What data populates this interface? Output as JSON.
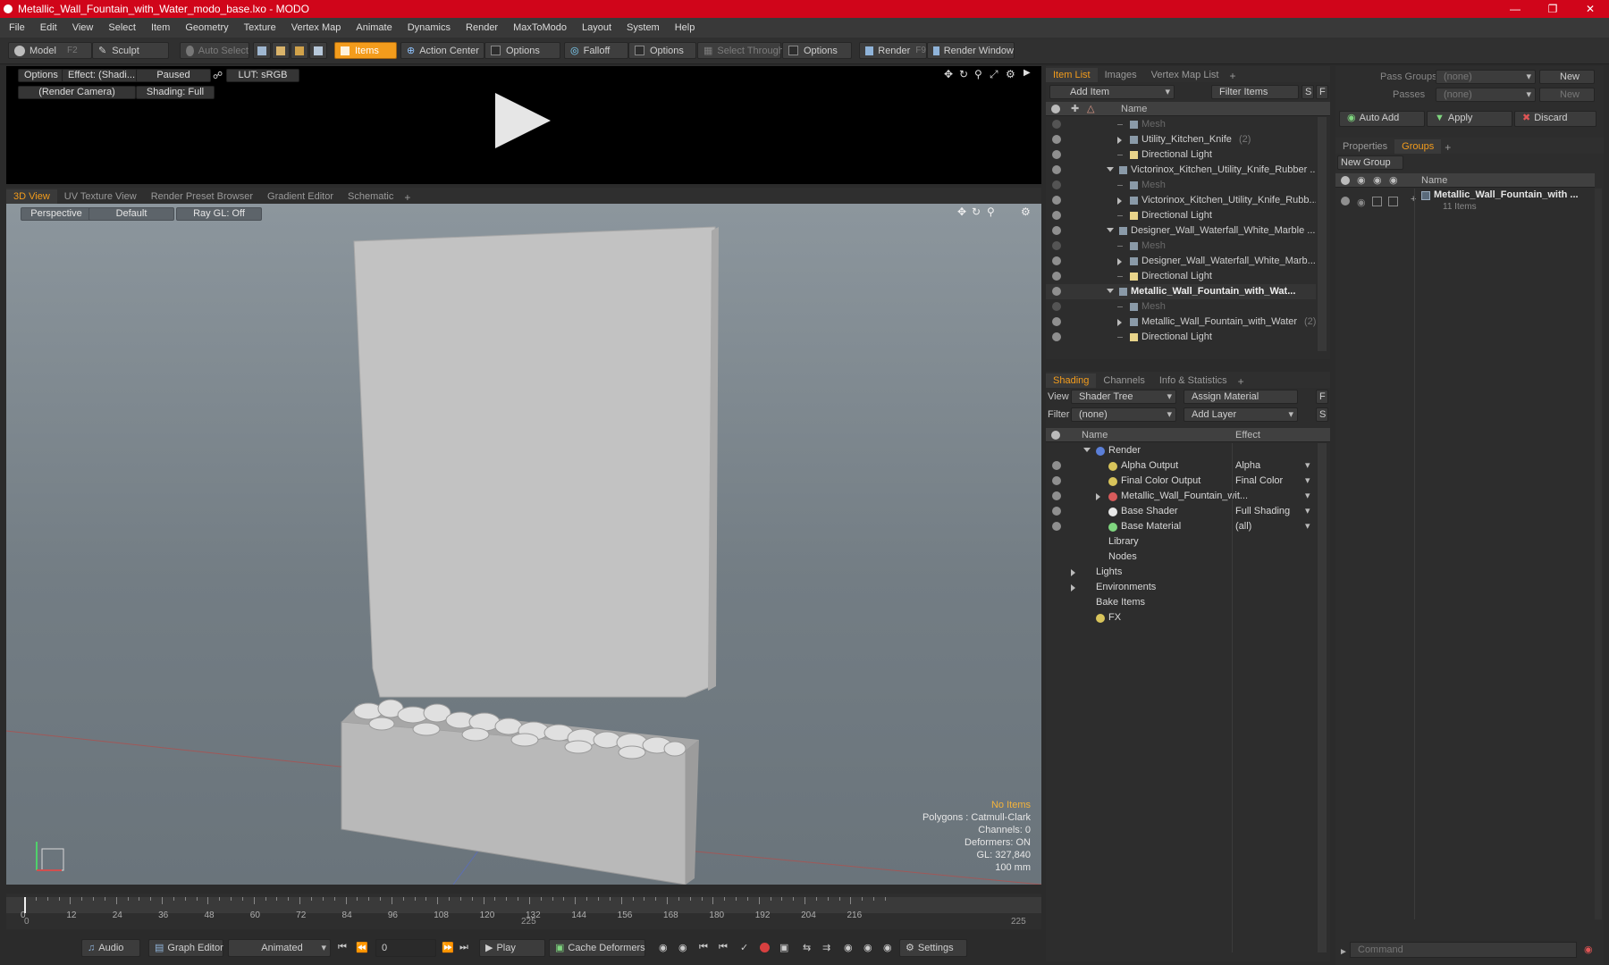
{
  "window": {
    "title": "Metallic_Wall_Fountain_with_Water_modo_base.lxo - MODO"
  },
  "menu": [
    "File",
    "Edit",
    "View",
    "Select",
    "Item",
    "Geometry",
    "Texture",
    "Vertex Map",
    "Animate",
    "Dynamics",
    "Render",
    "MaxToModo",
    "Layout",
    "System",
    "Help"
  ],
  "toolbar": {
    "model": "Model",
    "model_key": "F2",
    "sculpt": "Sculpt",
    "auto_select": "Auto Select",
    "items": "Items",
    "action_center": "Action Center",
    "options1": "Options",
    "falloff": "Falloff",
    "options2": "Options",
    "select_through": "Select Through",
    "options3": "Options",
    "render": "Render",
    "render_key": "F9",
    "render_window": "Render Window"
  },
  "preview": {
    "options": "Options",
    "effect": "Effect: (Shadi...",
    "paused": "Paused",
    "lut": "LUT: sRGB",
    "camera": "(Render Camera)",
    "shading": "Shading: Full"
  },
  "viewport_tabs": [
    "3D View",
    "UV Texture View",
    "Render Preset Browser",
    "Gradient Editor",
    "Schematic"
  ],
  "viewport": {
    "perspective": "Perspective",
    "default": "Default",
    "raygl": "Ray GL: Off",
    "stats": [
      "No Items",
      "Polygons : Catmull-Clark",
      "Channels: 0",
      "Deformers: ON",
      "GL: 327,840",
      "100 mm"
    ]
  },
  "timeline": {
    "ticks": [
      "0",
      "12",
      "24",
      "36",
      "48",
      "60",
      "72",
      "84",
      "96",
      "108",
      "120",
      "132",
      "144",
      "156",
      "168",
      "180",
      "192",
      "204",
      "216"
    ],
    "start": "0",
    "mid": "225",
    "end": "225"
  },
  "transport": {
    "audio": "Audio",
    "graph_editor": "Graph Editor",
    "animated": "Animated",
    "frame": "0",
    "play": "Play",
    "cache": "Cache Deformers",
    "settings": "Settings"
  },
  "item_list": {
    "tabs": [
      "Item List",
      "Images",
      "Vertex Map List"
    ],
    "add_item": "Add Item",
    "filter": "Filter Items",
    "s": "S",
    "f": "F",
    "col_name": "Name",
    "rows": [
      {
        "label": "Mesh",
        "indent": 3,
        "dim": true,
        "arrow": ""
      },
      {
        "label": "Utility_Kitchen_Knife",
        "extra": "(2)",
        "indent": 3,
        "arrow": "r"
      },
      {
        "label": "Directional Light",
        "indent": 3,
        "arrow": ""
      },
      {
        "label": "Victorinox_Kitchen_Utility_Knife_Rubber ...",
        "indent": 2,
        "arrow": "d"
      },
      {
        "label": "Mesh",
        "indent": 3,
        "dim": true,
        "arrow": ""
      },
      {
        "label": "Victorinox_Kitchen_Utility_Knife_Rubb...",
        "indent": 3,
        "arrow": "r"
      },
      {
        "label": "Directional Light",
        "indent": 3,
        "arrow": ""
      },
      {
        "label": "Designer_Wall_Waterfall_White_Marble ...",
        "indent": 2,
        "arrow": "d"
      },
      {
        "label": "Mesh",
        "indent": 3,
        "dim": true,
        "arrow": ""
      },
      {
        "label": "Designer_Wall_Waterfall_White_Marb...",
        "indent": 3,
        "arrow": "r"
      },
      {
        "label": "Directional Light",
        "indent": 3,
        "arrow": ""
      },
      {
        "label": "Metallic_Wall_Fountain_with_Wat...",
        "indent": 2,
        "arrow": "d",
        "bold": true
      },
      {
        "label": "Mesh",
        "indent": 3,
        "dim": true,
        "arrow": ""
      },
      {
        "label": "Metallic_Wall_Fountain_with_Water",
        "extra": "(2)",
        "indent": 3,
        "arrow": "r"
      },
      {
        "label": "Directional Light",
        "indent": 3,
        "arrow": ""
      }
    ]
  },
  "shading": {
    "tabs": [
      "Shading",
      "Channels",
      "Info & Statistics"
    ],
    "view_label": "View",
    "view_value": "Shader Tree",
    "assign": "Assign Material",
    "f": "F",
    "filter_label": "Filter",
    "filter_value": "(none)",
    "add_layer": "Add Layer",
    "s": "S",
    "col_name": "Name",
    "col_effect": "Effect",
    "rows": [
      {
        "label": "Render",
        "effect": "",
        "indent": 1,
        "arrow": "d",
        "eye": false
      },
      {
        "label": "Alpha Output",
        "effect": "Alpha",
        "indent": 2,
        "eye": true
      },
      {
        "label": "Final Color Output",
        "effect": "Final Color",
        "indent": 2,
        "eye": true
      },
      {
        "label": "Metallic_Wall_Fountain_wit...",
        "effect": "",
        "indent": 2,
        "eye": true,
        "arrow": "r"
      },
      {
        "label": "Base Shader",
        "effect": "Full Shading",
        "indent": 2,
        "eye": true
      },
      {
        "label": "Base Material",
        "effect": "(all)",
        "indent": 2,
        "eye": true
      },
      {
        "label": "Library",
        "effect": "",
        "indent": 1,
        "eye": false
      },
      {
        "label": "Nodes",
        "effect": "",
        "indent": 1,
        "eye": false
      },
      {
        "label": "Lights",
        "effect": "",
        "indent": 0,
        "eye": false,
        "arrow": "r"
      },
      {
        "label": "Environments",
        "effect": "",
        "indent": 0,
        "eye": false,
        "arrow": "r"
      },
      {
        "label": "Bake Items",
        "effect": "",
        "indent": 0,
        "eye": false
      },
      {
        "label": "FX",
        "effect": "",
        "indent": 1,
        "eye": false
      }
    ]
  },
  "groups": {
    "pass_groups_label": "Pass Groups",
    "pass_groups_value": "(none)",
    "new": "New",
    "passes_label": "Passes",
    "passes_value": "(none)",
    "new2": "New",
    "auto_add": "Auto Add",
    "apply": "Apply",
    "discard": "Discard",
    "tabs": [
      "Properties",
      "Groups"
    ],
    "new_group": "New Group",
    "col_name": "Name",
    "item_name": "Metallic_Wall_Fountain_with ...",
    "item_count": "11 Items"
  },
  "command": {
    "placeholder": "Command"
  }
}
